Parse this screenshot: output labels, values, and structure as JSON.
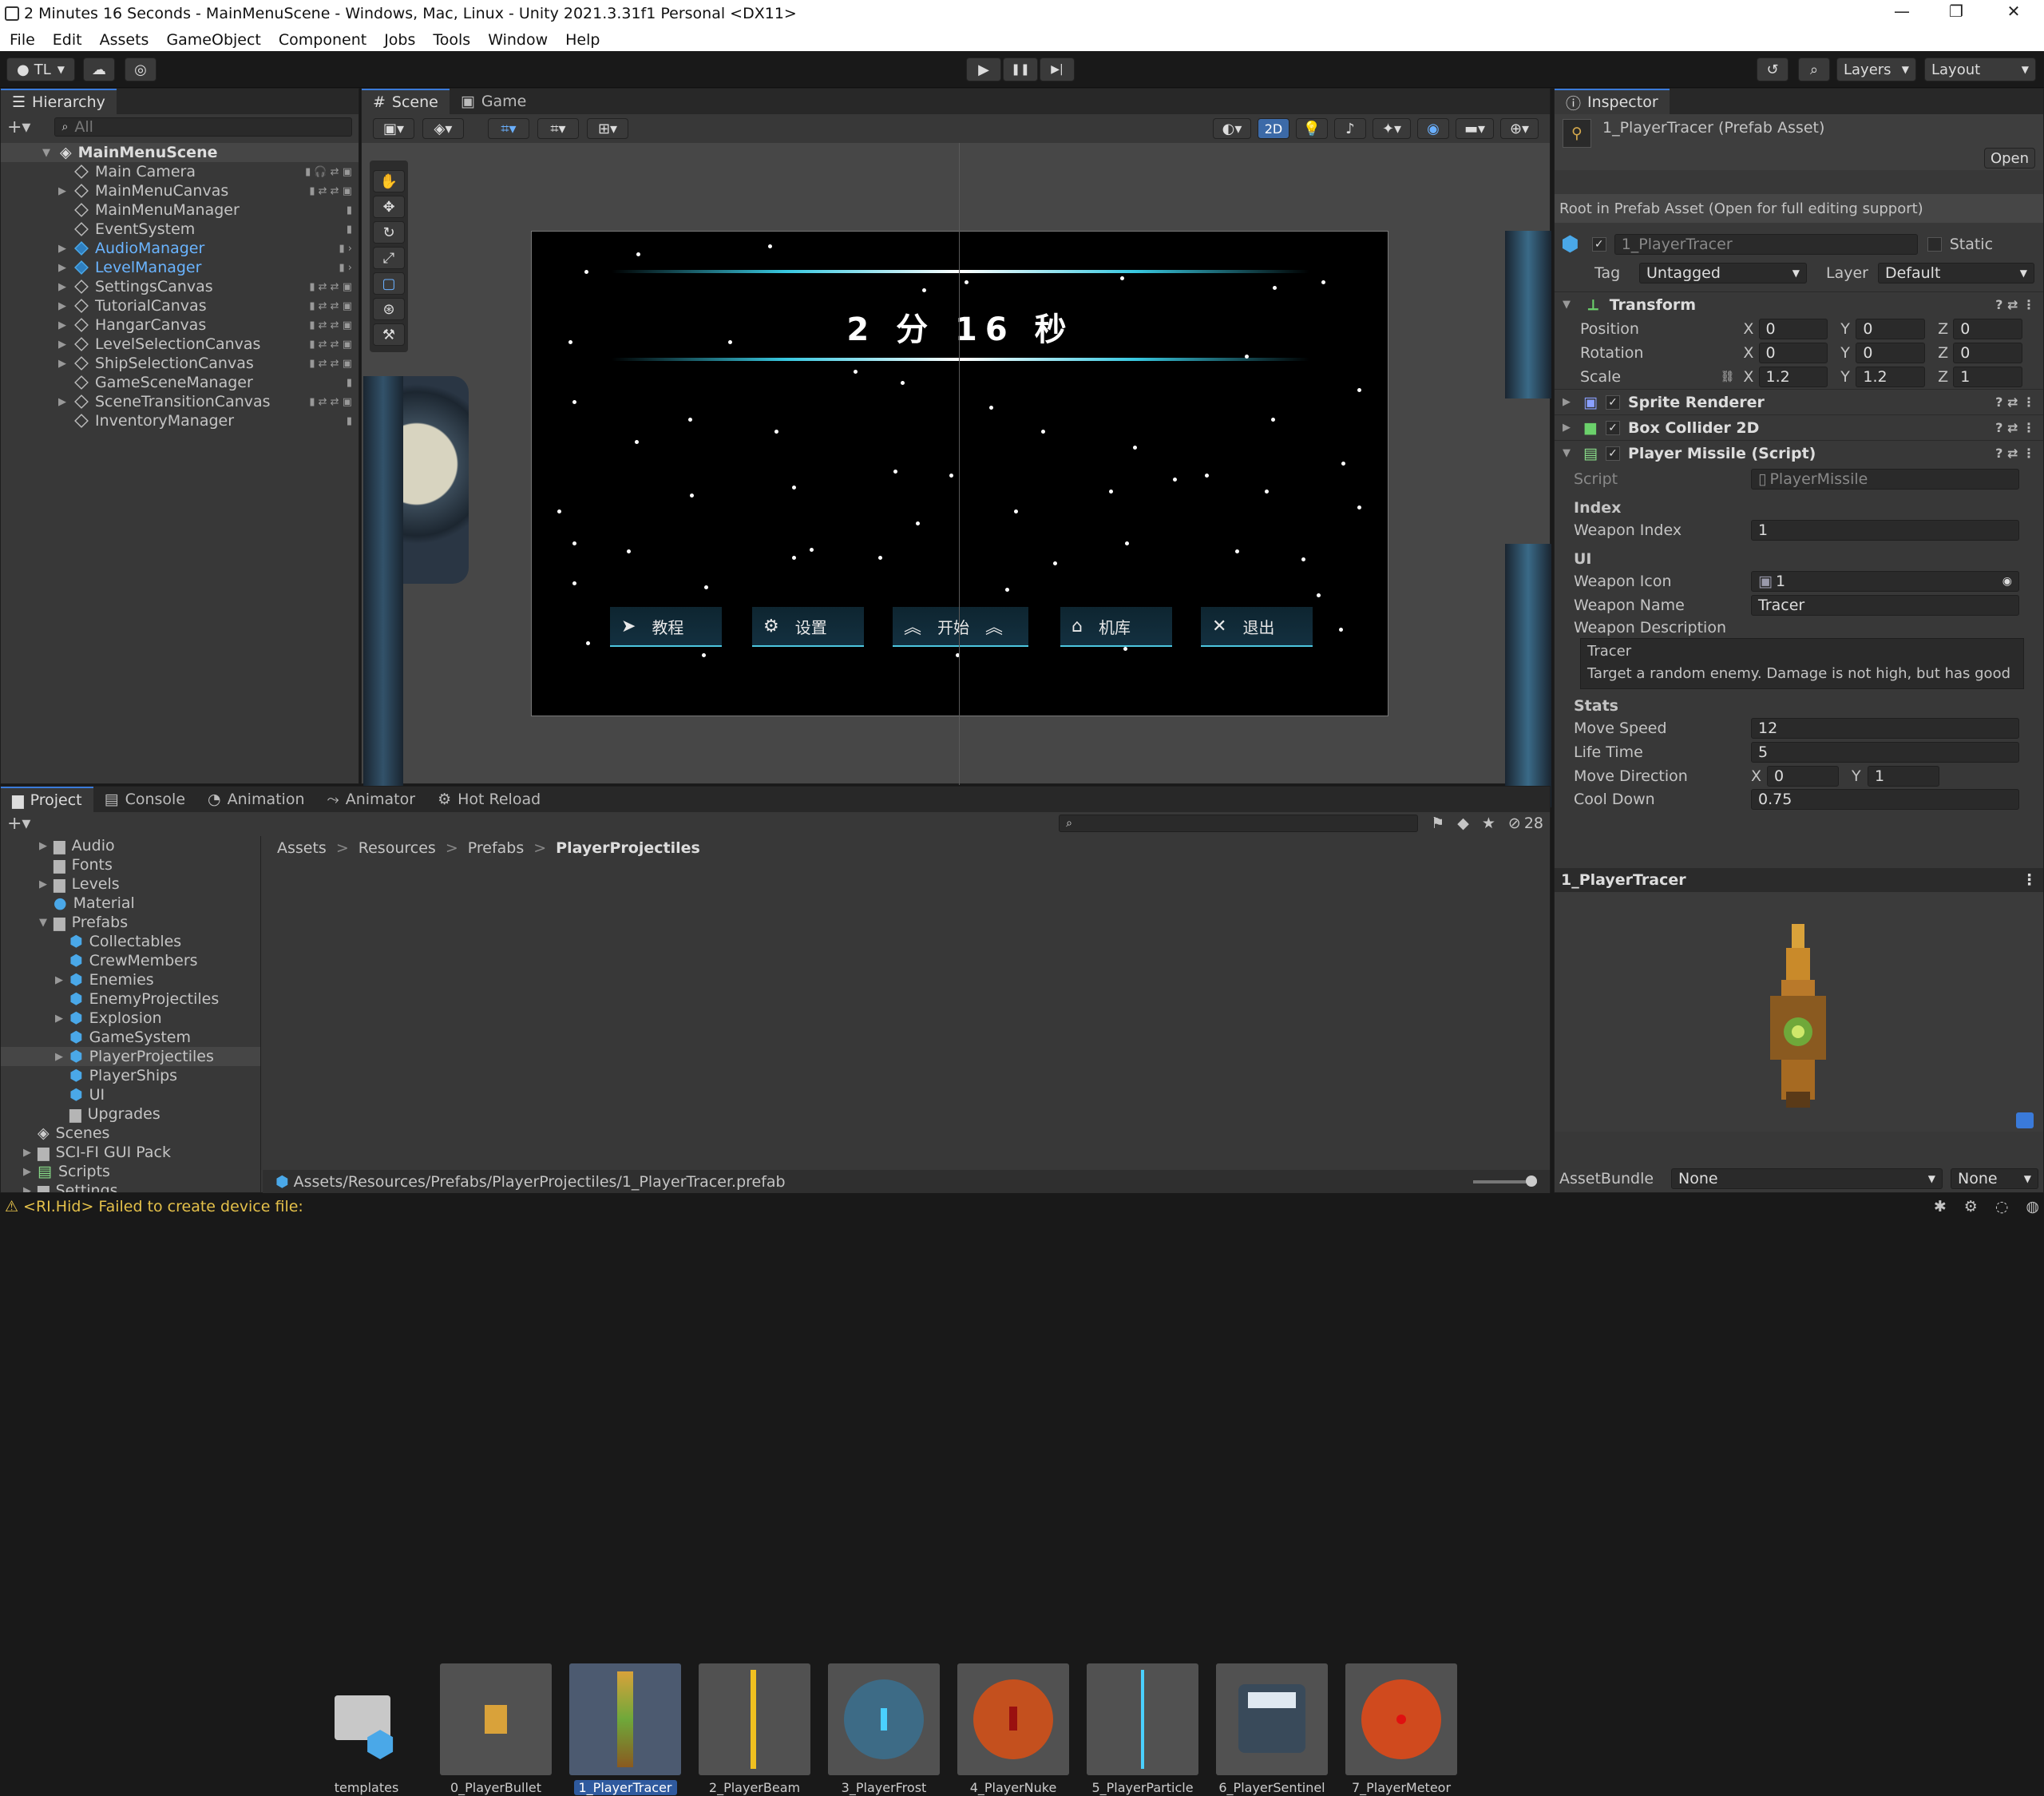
{
  "window": {
    "title": "2 Minutes 16 Seconds - MainMenuScene - Windows, Mac, Linux - Unity 2021.3.31f1 Personal <DX11>",
    "min": "—",
    "max": "❐",
    "close": "✕"
  },
  "menu": [
    "File",
    "Edit",
    "Assets",
    "GameObject",
    "Component",
    "Jobs",
    "Tools",
    "Window",
    "Help"
  ],
  "toolbar": {
    "account": "TL",
    "play": "▶",
    "pause": "❚❚",
    "step": "▶|",
    "layers": "Layers",
    "layout": "Layout"
  },
  "hierarchy": {
    "tab": "Hierarchy",
    "search_placeholder": "All",
    "scene": "MainMenuScene",
    "items": [
      {
        "name": "Main Camera",
        "expand": ""
      },
      {
        "name": "MainMenuCanvas",
        "expand": "▶"
      },
      {
        "name": "MainMenuManager",
        "expand": ""
      },
      {
        "name": "EventSystem",
        "expand": ""
      },
      {
        "name": "AudioManager",
        "expand": "▶"
      },
      {
        "name": "LevelManager",
        "expand": "▶"
      },
      {
        "name": "SettingsCanvas",
        "expand": "▶"
      },
      {
        "name": "TutorialCanvas",
        "expand": "▶"
      },
      {
        "name": "HangarCanvas",
        "expand": "▶"
      },
      {
        "name": "LevelSelectionCanvas",
        "expand": "▶"
      },
      {
        "name": "ShipSelectionCanvas",
        "expand": "▶"
      },
      {
        "name": "GameSceneManager",
        "expand": ""
      },
      {
        "name": "SceneTransitionCanvas",
        "expand": "▶"
      },
      {
        "name": "InventoryManager",
        "expand": ""
      }
    ]
  },
  "scene": {
    "tab_scene": "Scene",
    "tab_game": "Game",
    "mode_2d": "2D",
    "game_title": "2 分 16 秒",
    "buttons": [
      {
        "label": "教程",
        "icon": "paper-plane-icon",
        "glyph": "➤"
      },
      {
        "label": "设置",
        "icon": "gear-icon",
        "glyph": "⚙"
      },
      {
        "label": "开始",
        "icon": "chevron-up-icon",
        "glyph": "︽"
      },
      {
        "label": "机库",
        "icon": "home-icon",
        "glyph": "⌂"
      },
      {
        "label": "退出",
        "icon": "close-icon",
        "glyph": "✕"
      }
    ]
  },
  "project": {
    "tabs": [
      "Project",
      "Console",
      "Animation",
      "Animator",
      "Hot Reload"
    ],
    "count": "28",
    "tree": [
      {
        "name": "Audio",
        "type": "folder",
        "expand": "▶"
      },
      {
        "name": "Fonts",
        "type": "folder",
        "expand": ""
      },
      {
        "name": "Levels",
        "type": "folder",
        "expand": "▶"
      },
      {
        "name": "Material",
        "type": "material",
        "expand": ""
      },
      {
        "name": "Prefabs",
        "type": "folder",
        "expand": "▼"
      },
      {
        "name": "Collectables",
        "type": "prefab",
        "expand": ""
      },
      {
        "name": "CrewMembers",
        "type": "prefab",
        "expand": ""
      },
      {
        "name": "Enemies",
        "type": "prefab",
        "expand": "▶"
      },
      {
        "name": "EnemyProjectiles",
        "type": "prefab",
        "expand": ""
      },
      {
        "name": "Explosion",
        "type": "prefab",
        "expand": "▶"
      },
      {
        "name": "GameSystem",
        "type": "prefab",
        "expand": ""
      },
      {
        "name": "PlayerProjectiles",
        "type": "prefab",
        "expand": "▶"
      },
      {
        "name": "PlayerShips",
        "type": "prefab",
        "expand": ""
      },
      {
        "name": "UI",
        "type": "prefab",
        "expand": ""
      },
      {
        "name": "Upgrades",
        "type": "folder",
        "expand": ""
      },
      {
        "name": "Scenes",
        "type": "scene",
        "expand": ""
      },
      {
        "name": "SCI-FI GUI Pack",
        "type": "folder",
        "expand": "▶"
      },
      {
        "name": "Scripts",
        "type": "script",
        "expand": "▶"
      },
      {
        "name": "Settings",
        "type": "folder",
        "expand": "▶"
      }
    ],
    "breadcrumb": [
      "Assets",
      "Resources",
      "Prefabs",
      "PlayerProjectiles"
    ],
    "assets": [
      "templates",
      "0_PlayerBullet",
      "1_PlayerTracer",
      "2_PlayerBeam",
      "3_PlayerFrost",
      "4_PlayerNuke",
      "5_PlayerParticle",
      "6_PlayerSentinel",
      "7_PlayerMeteor"
    ],
    "path": "Assets/Resources/Prefabs/PlayerProjectiles/1_PlayerTracer.prefab"
  },
  "inspector": {
    "tab": "Inspector",
    "asset_title": "1_PlayerTracer (Prefab Asset)",
    "open": "Open",
    "root_note": "Root in Prefab Asset (Open for full editing support)",
    "name": "1_PlayerTracer",
    "static": "Static",
    "tag_label": "Tag",
    "tag": "Untagged",
    "layer_label": "Layer",
    "layer": "Default",
    "transform": {
      "title": "Transform",
      "position": {
        "label": "Position",
        "x": "0",
        "y": "0",
        "z": "0"
      },
      "rotation": {
        "label": "Rotation",
        "x": "0",
        "y": "0",
        "z": "0"
      },
      "scale": {
        "label": "Scale",
        "x": "1.2",
        "y": "1.2",
        "z": "1"
      }
    },
    "components": [
      "Sprite Renderer",
      "Box Collider 2D",
      "Player Missile (Script)"
    ],
    "script_label": "Script",
    "script": "PlayerMissile",
    "index_header": "Index",
    "weapon_index_label": "Weapon Index",
    "weapon_index": "1",
    "ui_header": "UI",
    "weapon_icon_label": "Weapon Icon",
    "weapon_icon": "1",
    "weapon_name_label": "Weapon Name",
    "weapon_name": "Tracer",
    "weapon_desc_label": "Weapon Description",
    "weapon_desc_line1": "Tracer",
    "weapon_desc_line2": "Target a random enemy. Damage is not high, but has good",
    "stats_header": "Stats",
    "move_speed_label": "Move Speed",
    "move_speed": "12",
    "life_time_label": "Life Time",
    "life_time": "5",
    "move_dir_label": "Move Direction",
    "move_dir_x": "0",
    "move_dir_y": "1",
    "cooldown_label": "Cool Down",
    "cooldown": "0.75",
    "preview_title": "1_PlayerTracer",
    "assetbundle_label": "AssetBundle",
    "assetbundle": "None",
    "assetbundle_variant": "None"
  },
  "status": {
    "message": "<RI.Hid> Failed to create device file:"
  },
  "labels": {
    "x": "X",
    "y": "Y",
    "z": "Z",
    "sep": ">"
  }
}
